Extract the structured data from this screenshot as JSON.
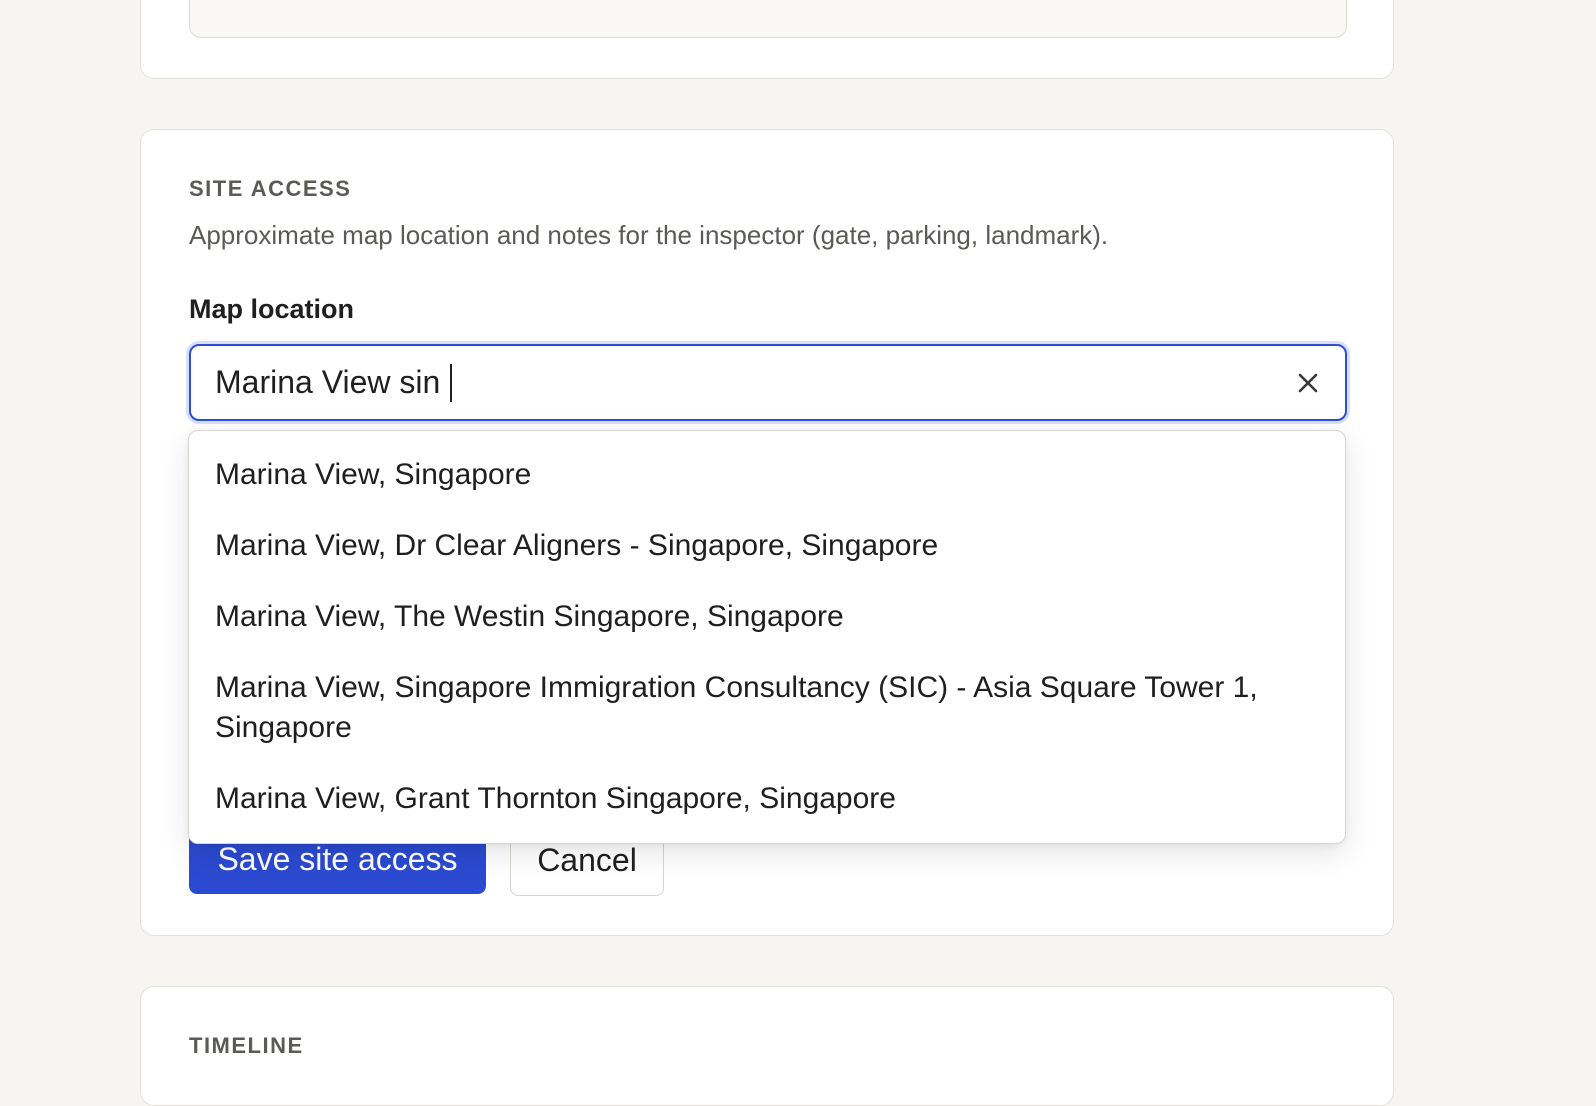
{
  "site_access": {
    "title": "SITE ACCESS",
    "description": "Approximate map location and notes for the inspector (gate, parking, landmark).",
    "map_label": "Map location",
    "search_value": "Marina View sin",
    "suggestions": [
      "Marina View, Singapore",
      "Marina View, Dr Clear Aligners - Singapore, Singapore",
      "Marina View, The Westin Singapore, Singapore",
      "Marina View, Singapore Immigration Consultancy (SIC) - Asia Square Tower 1, Singapore",
      "Marina View, Grant Thornton Singapore, Singapore"
    ],
    "save_label": "Save site access",
    "cancel_label": "Cancel"
  },
  "timeline": {
    "title": "TIMELINE"
  },
  "icons": {
    "clear": "close-icon"
  },
  "colors": {
    "accent": "#2b4ad1",
    "focus_ring": "#2d4fd6",
    "background": "#f6f5f2"
  }
}
